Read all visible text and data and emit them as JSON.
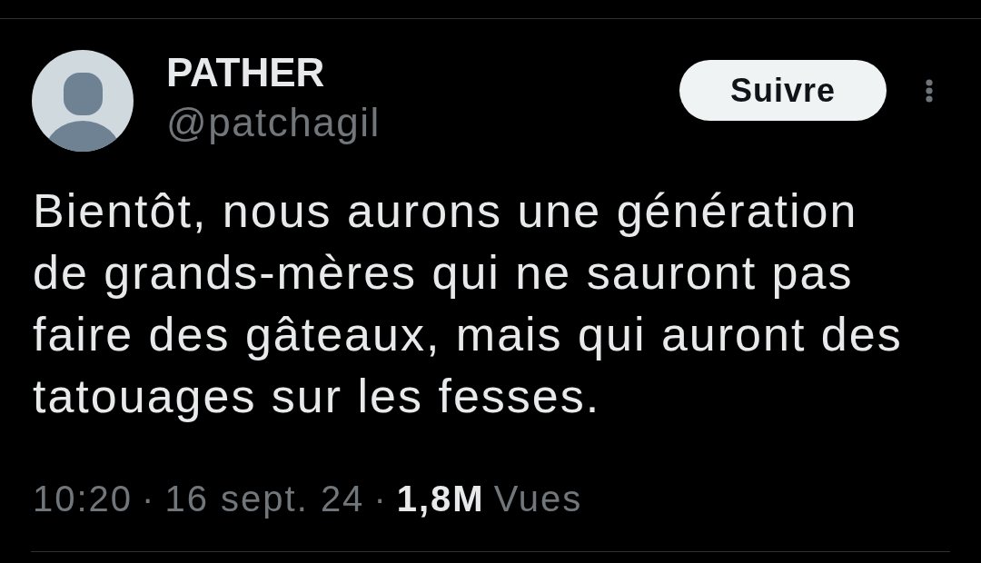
{
  "author": {
    "name": "PATHER",
    "handle": "@patchagil"
  },
  "follow_button": {
    "label": "Suivre"
  },
  "tweet": {
    "text": "Bientôt, nous aurons une génération de grands-mères qui ne sauront pas faire des gâteaux, mais qui auront des tatouages sur les fesses."
  },
  "meta": [
    {
      "kind": "time",
      "text": "10:20"
    },
    {
      "kind": "separator",
      "text": "·"
    },
    {
      "kind": "date",
      "text": "16 sept. 24"
    },
    {
      "kind": "separator",
      "text": "·"
    },
    {
      "kind": "views",
      "count": "1,8M",
      "label": "Vues"
    }
  ]
}
